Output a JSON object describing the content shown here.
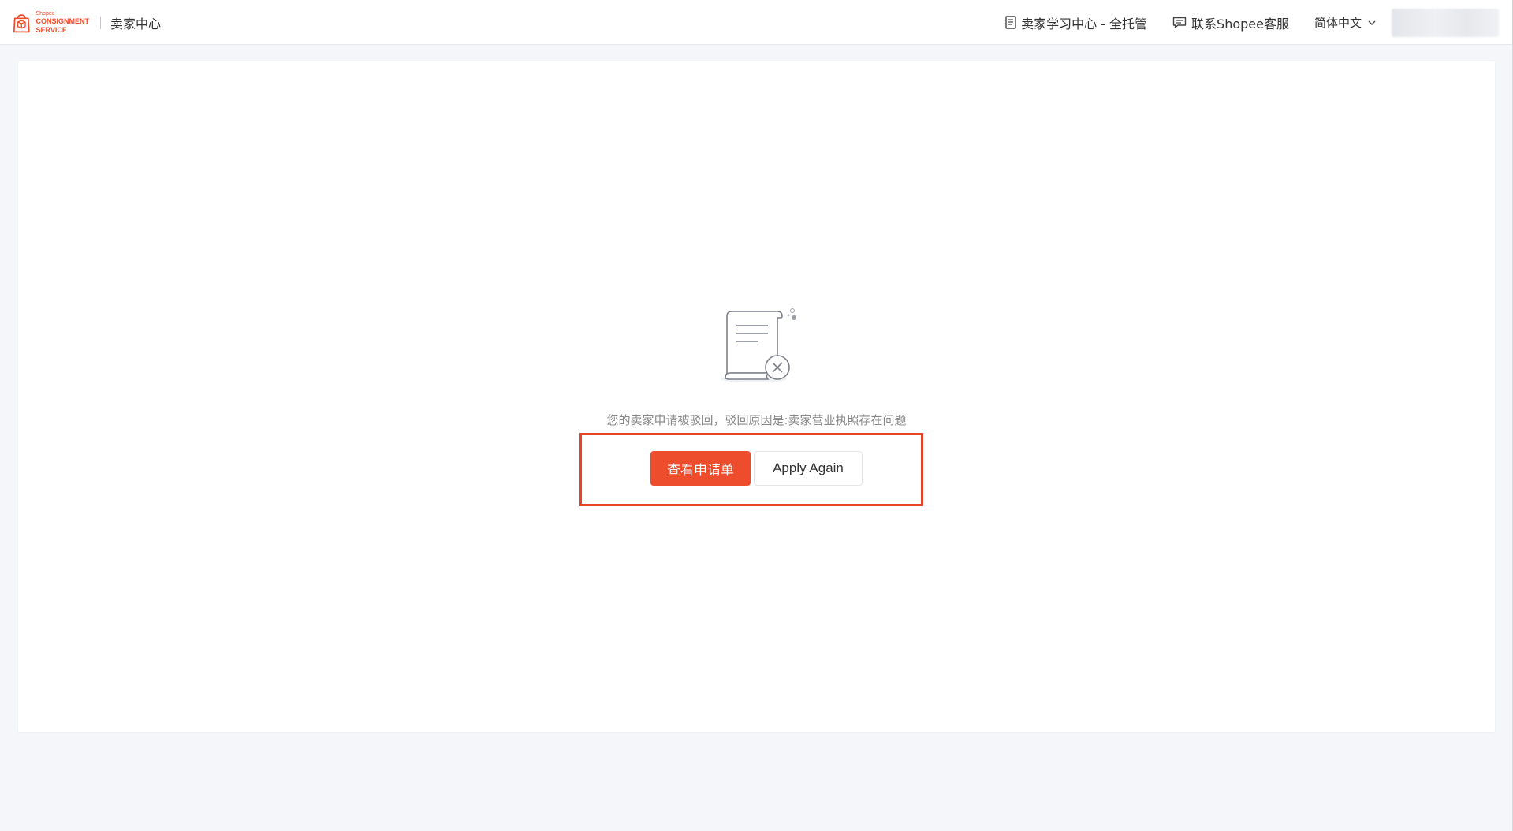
{
  "header": {
    "brand_small": "Shopee",
    "brand_line1": "CONSIGNMENT",
    "brand_line2": "SERVICE",
    "title": "卖家中心",
    "links": [
      {
        "label": "卖家学习中心 - 全托管",
        "icon": "document-icon"
      },
      {
        "label": "联系Shopee客服",
        "icon": "chat-icon"
      }
    ],
    "language": "简体中文"
  },
  "main": {
    "illustration_icon": "rejected-document-icon",
    "message": "您的卖家申请被驳回，驳回原因是:卖家营业执照存在问题",
    "primary_button": "查看申请单",
    "secondary_button": "Apply Again"
  },
  "colors": {
    "brand": "#ee4d2d",
    "highlight": "#e8412c",
    "background": "#f5f6f9"
  }
}
